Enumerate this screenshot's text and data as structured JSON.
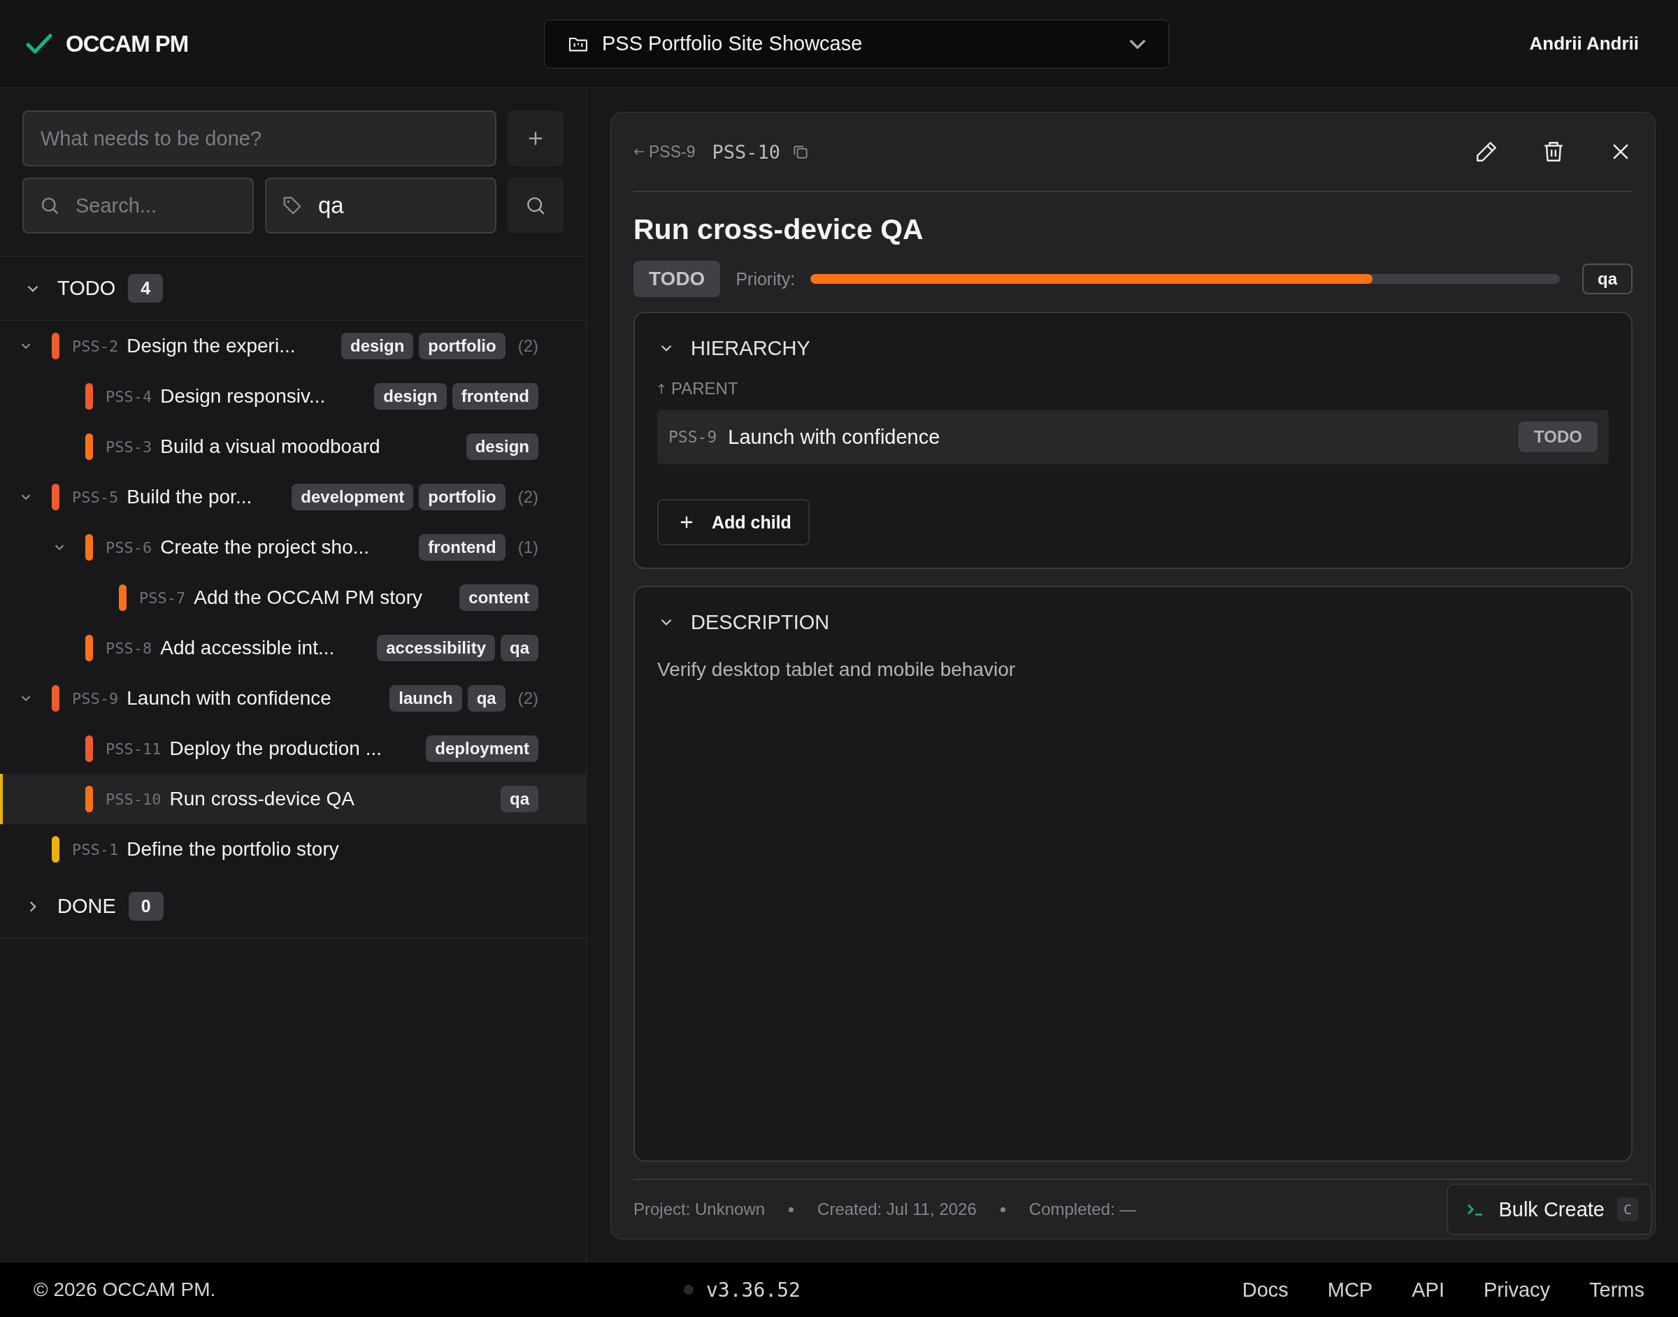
{
  "header": {
    "logo": "OCCAM PM",
    "project": "PSS Portfolio Site Showcase",
    "user": "Andrii Andrii"
  },
  "sidebar": {
    "new_task": {
      "placeholder": "What needs to be done?"
    },
    "search": {
      "placeholder": "Search..."
    },
    "tag_filter": {
      "value": "qa"
    },
    "sections": [
      {
        "title": "TODO",
        "count": "4",
        "expanded": true,
        "items": [
          {
            "id": "PSS-2",
            "title": "Design the experi...",
            "tags": [
              "design",
              "portfolio"
            ],
            "count": "(2)",
            "color": "#ef5a2f",
            "expanded": true,
            "selected": false,
            "children": [
              {
                "id": "PSS-4",
                "title": "Design responsiv...",
                "tags": [
                  "design",
                  "frontend"
                ],
                "color": "#ef5a2f",
                "selected": false
              },
              {
                "id": "PSS-3",
                "title": "Build a visual moodboard",
                "tags": [
                  "design"
                ],
                "color": "#f97316",
                "selected": false
              }
            ]
          },
          {
            "id": "PSS-5",
            "title": "Build the por...",
            "tags": [
              "development",
              "portfolio"
            ],
            "count": "(2)",
            "color": "#ef5a2f",
            "expanded": true,
            "selected": false,
            "children": [
              {
                "id": "PSS-6",
                "title": "Create the project sho...",
                "tags": [
                  "frontend"
                ],
                "count": "(1)",
                "color": "#f97316",
                "expanded": true,
                "selected": false,
                "children": [
                  {
                    "id": "PSS-7",
                    "title": "Add the OCCAM PM story",
                    "tags": [
                      "content"
                    ],
                    "color": "#f97316",
                    "selected": false
                  }
                ]
              },
              {
                "id": "PSS-8",
                "title": "Add accessible int...",
                "tags": [
                  "accessibility",
                  "qa"
                ],
                "color": "#f97316",
                "selected": false
              }
            ]
          },
          {
            "id": "PSS-9",
            "title": "Launch with confidence",
            "tags": [
              "launch",
              "qa"
            ],
            "count": "(2)",
            "color": "#ef5a2f",
            "expanded": true,
            "selected": false,
            "children": [
              {
                "id": "PSS-11",
                "title": "Deploy the production ...",
                "tags": [
                  "deployment"
                ],
                "color": "#ef5a2f",
                "selected": false
              },
              {
                "id": "PSS-10",
                "title": "Run cross-device QA",
                "tags": [
                  "qa"
                ],
                "color": "#f97316",
                "selected": true
              }
            ]
          },
          {
            "id": "PSS-1",
            "title": "Define the portfolio story",
            "color": "#eab308",
            "selected": false
          }
        ]
      },
      {
        "title": "DONE",
        "count": "0",
        "expanded": false
      }
    ]
  },
  "detail": {
    "back": "PSS-9",
    "id": "PSS-10",
    "title": "Run cross-device QA",
    "status": "TODO",
    "priority_label": "Priority:",
    "priority": {
      "level": 0.75
    },
    "tags": [
      "qa"
    ],
    "hierarchy": {
      "title": "HIERARCHY",
      "expanded": true,
      "parent_label": "PARENT",
      "parent": {
        "id": "PSS-9",
        "title": "Launch with confidence",
        "status": "TODO"
      },
      "add_child": "Add child"
    },
    "description": {
      "title": "DESCRIPTION",
      "expanded": true,
      "text": "Verify desktop tablet and mobile behavior"
    },
    "meta": [
      "Project: Unknown",
      "Created: Jul 11, 2026",
      "Completed: —"
    ],
    "bulk_create": {
      "label": "Bulk Create",
      "shortcut": "C"
    }
  },
  "footer": {
    "copyright": "© 2026 OCCAM PM.",
    "version": "v3.36.52",
    "links": [
      "Docs",
      "MCP",
      "API",
      "Privacy",
      "Terms"
    ]
  }
}
